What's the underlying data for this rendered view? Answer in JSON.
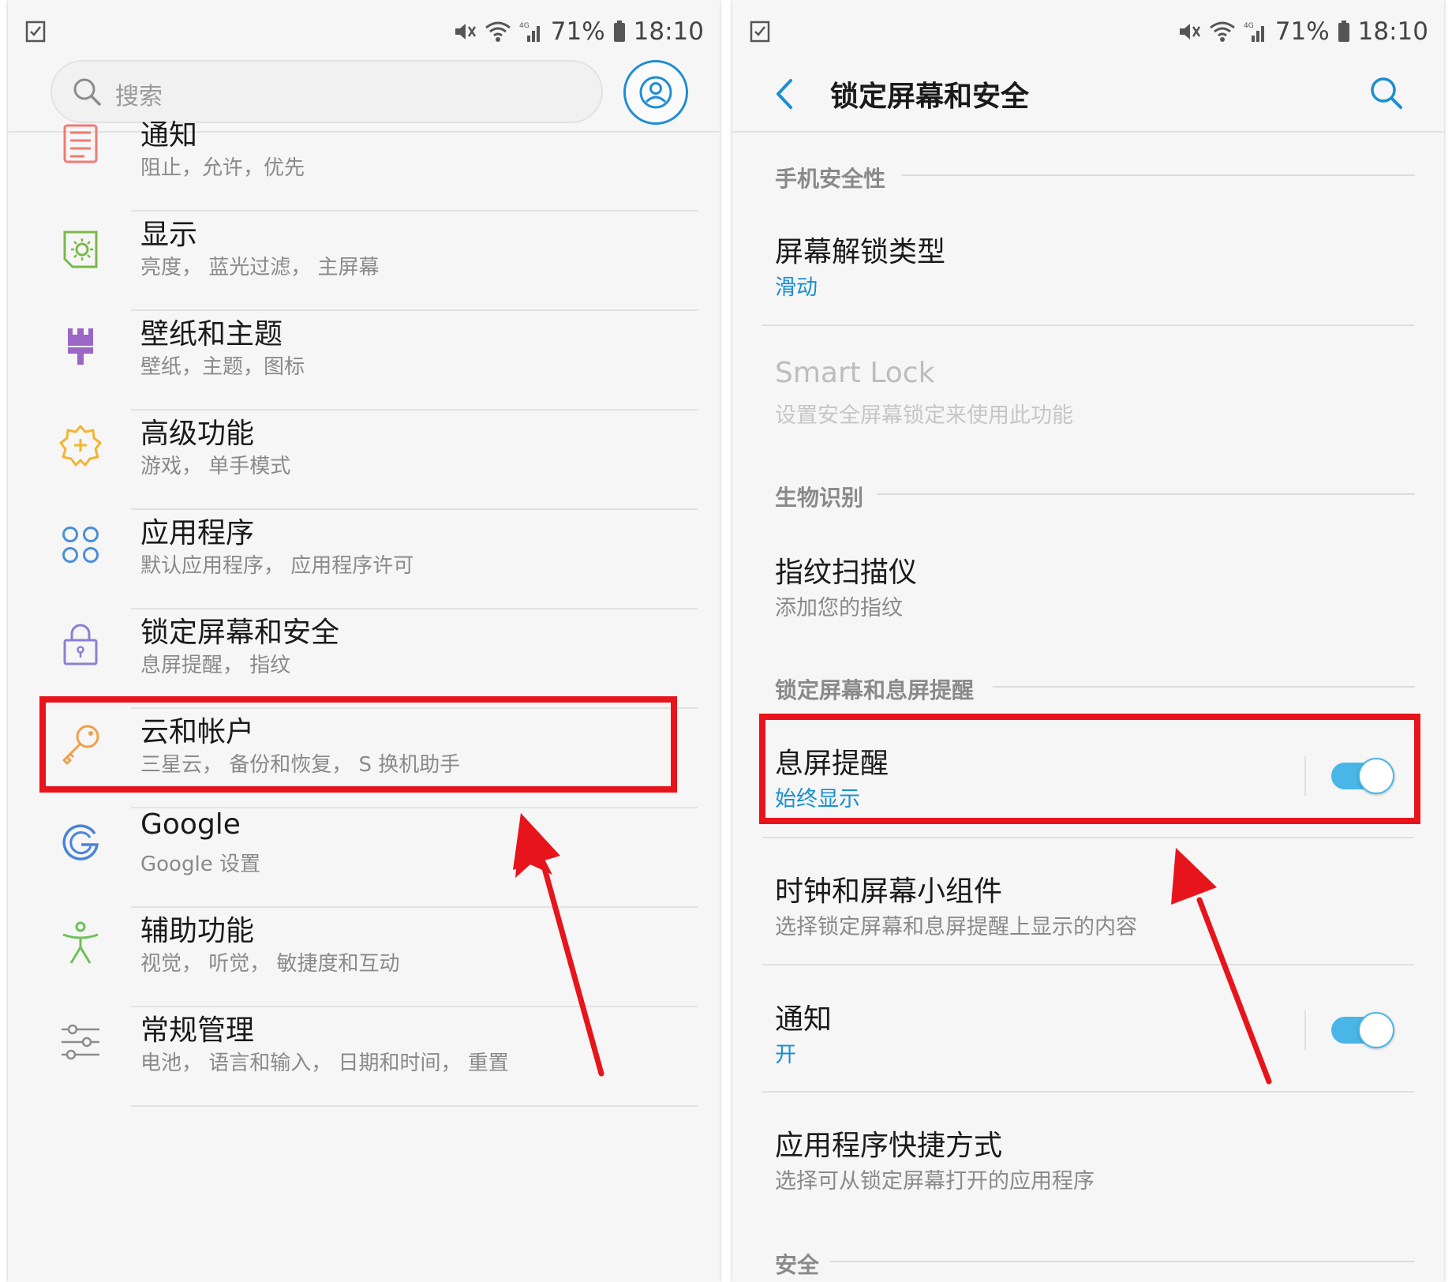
{
  "status_bar": {
    "battery": "71%",
    "time": "18:10",
    "network": "4G",
    "icons": [
      "notification-check-icon",
      "mute-vibrate-icon",
      "wifi-icon",
      "signal-icon",
      "battery-icon"
    ]
  },
  "left_screen": {
    "search": {
      "placeholder": "搜索"
    },
    "items": [
      {
        "title": "通知",
        "subtitle": "阻止，允许，优先",
        "icon": "notifications-icon"
      },
      {
        "title": "显示",
        "subtitle": "亮度， 蓝光过滤， 主屏幕",
        "icon": "display-icon"
      },
      {
        "title": "壁纸和主题",
        "subtitle": "壁纸，主题，图标",
        "icon": "wallpaper-brush-icon"
      },
      {
        "title": "高级功能",
        "subtitle": "游戏， 单手模式",
        "icon": "advanced-features-gear-icon"
      },
      {
        "title": "应用程序",
        "subtitle": "默认应用程序， 应用程序许可",
        "icon": "apps-icon"
      },
      {
        "title": "锁定屏幕和安全",
        "subtitle": "息屏提醒， 指纹",
        "icon": "lock-icon"
      },
      {
        "title": "云和帐户",
        "subtitle": "三星云， 备份和恢复， S 换机助手",
        "icon": "key-icon"
      },
      {
        "title": "Google",
        "subtitle": "Google 设置",
        "icon": "google-icon"
      },
      {
        "title": "辅助功能",
        "subtitle": "视觉， 听觉， 敏捷度和互动",
        "icon": "accessibility-icon"
      },
      {
        "title": "常规管理",
        "subtitle": "电池， 语言和输入， 日期和时间， 重置",
        "icon": "general-management-sliders-icon"
      }
    ]
  },
  "right_screen": {
    "title": "锁定屏幕和安全",
    "sections": {
      "phone_security": "手机安全性",
      "biometrics": "生物识别",
      "lock_screen_aod": "锁定屏幕和息屏提醒",
      "security": "安全"
    },
    "items": {
      "unlock_type": {
        "title": "屏幕解锁类型",
        "subtitle": "滑动"
      },
      "smart_lock": {
        "title": "Smart Lock",
        "subtitle": "设置安全屏幕锁定来使用此功能"
      },
      "fingerprint": {
        "title": "指纹扫描仪",
        "subtitle": "添加您的指纹"
      },
      "always_on_display": {
        "title": "息屏提醒",
        "subtitle": "始终显示",
        "toggle_on": true
      },
      "clock_widgets": {
        "title": "时钟和屏幕小组件",
        "subtitle": "选择锁定屏幕和息屏提醒上显示的内容"
      },
      "notifications": {
        "title": "通知",
        "subtitle": "开",
        "toggle_on": true
      },
      "app_shortcuts": {
        "title": "应用程序快捷方式",
        "subtitle": "选择可从锁定屏幕打开的应用程序"
      }
    }
  },
  "colors": {
    "accent": "#1b8fd0",
    "toggle": "#4ab6e8",
    "annotation_red": "#e8141b",
    "background": "#f6f6f6"
  }
}
